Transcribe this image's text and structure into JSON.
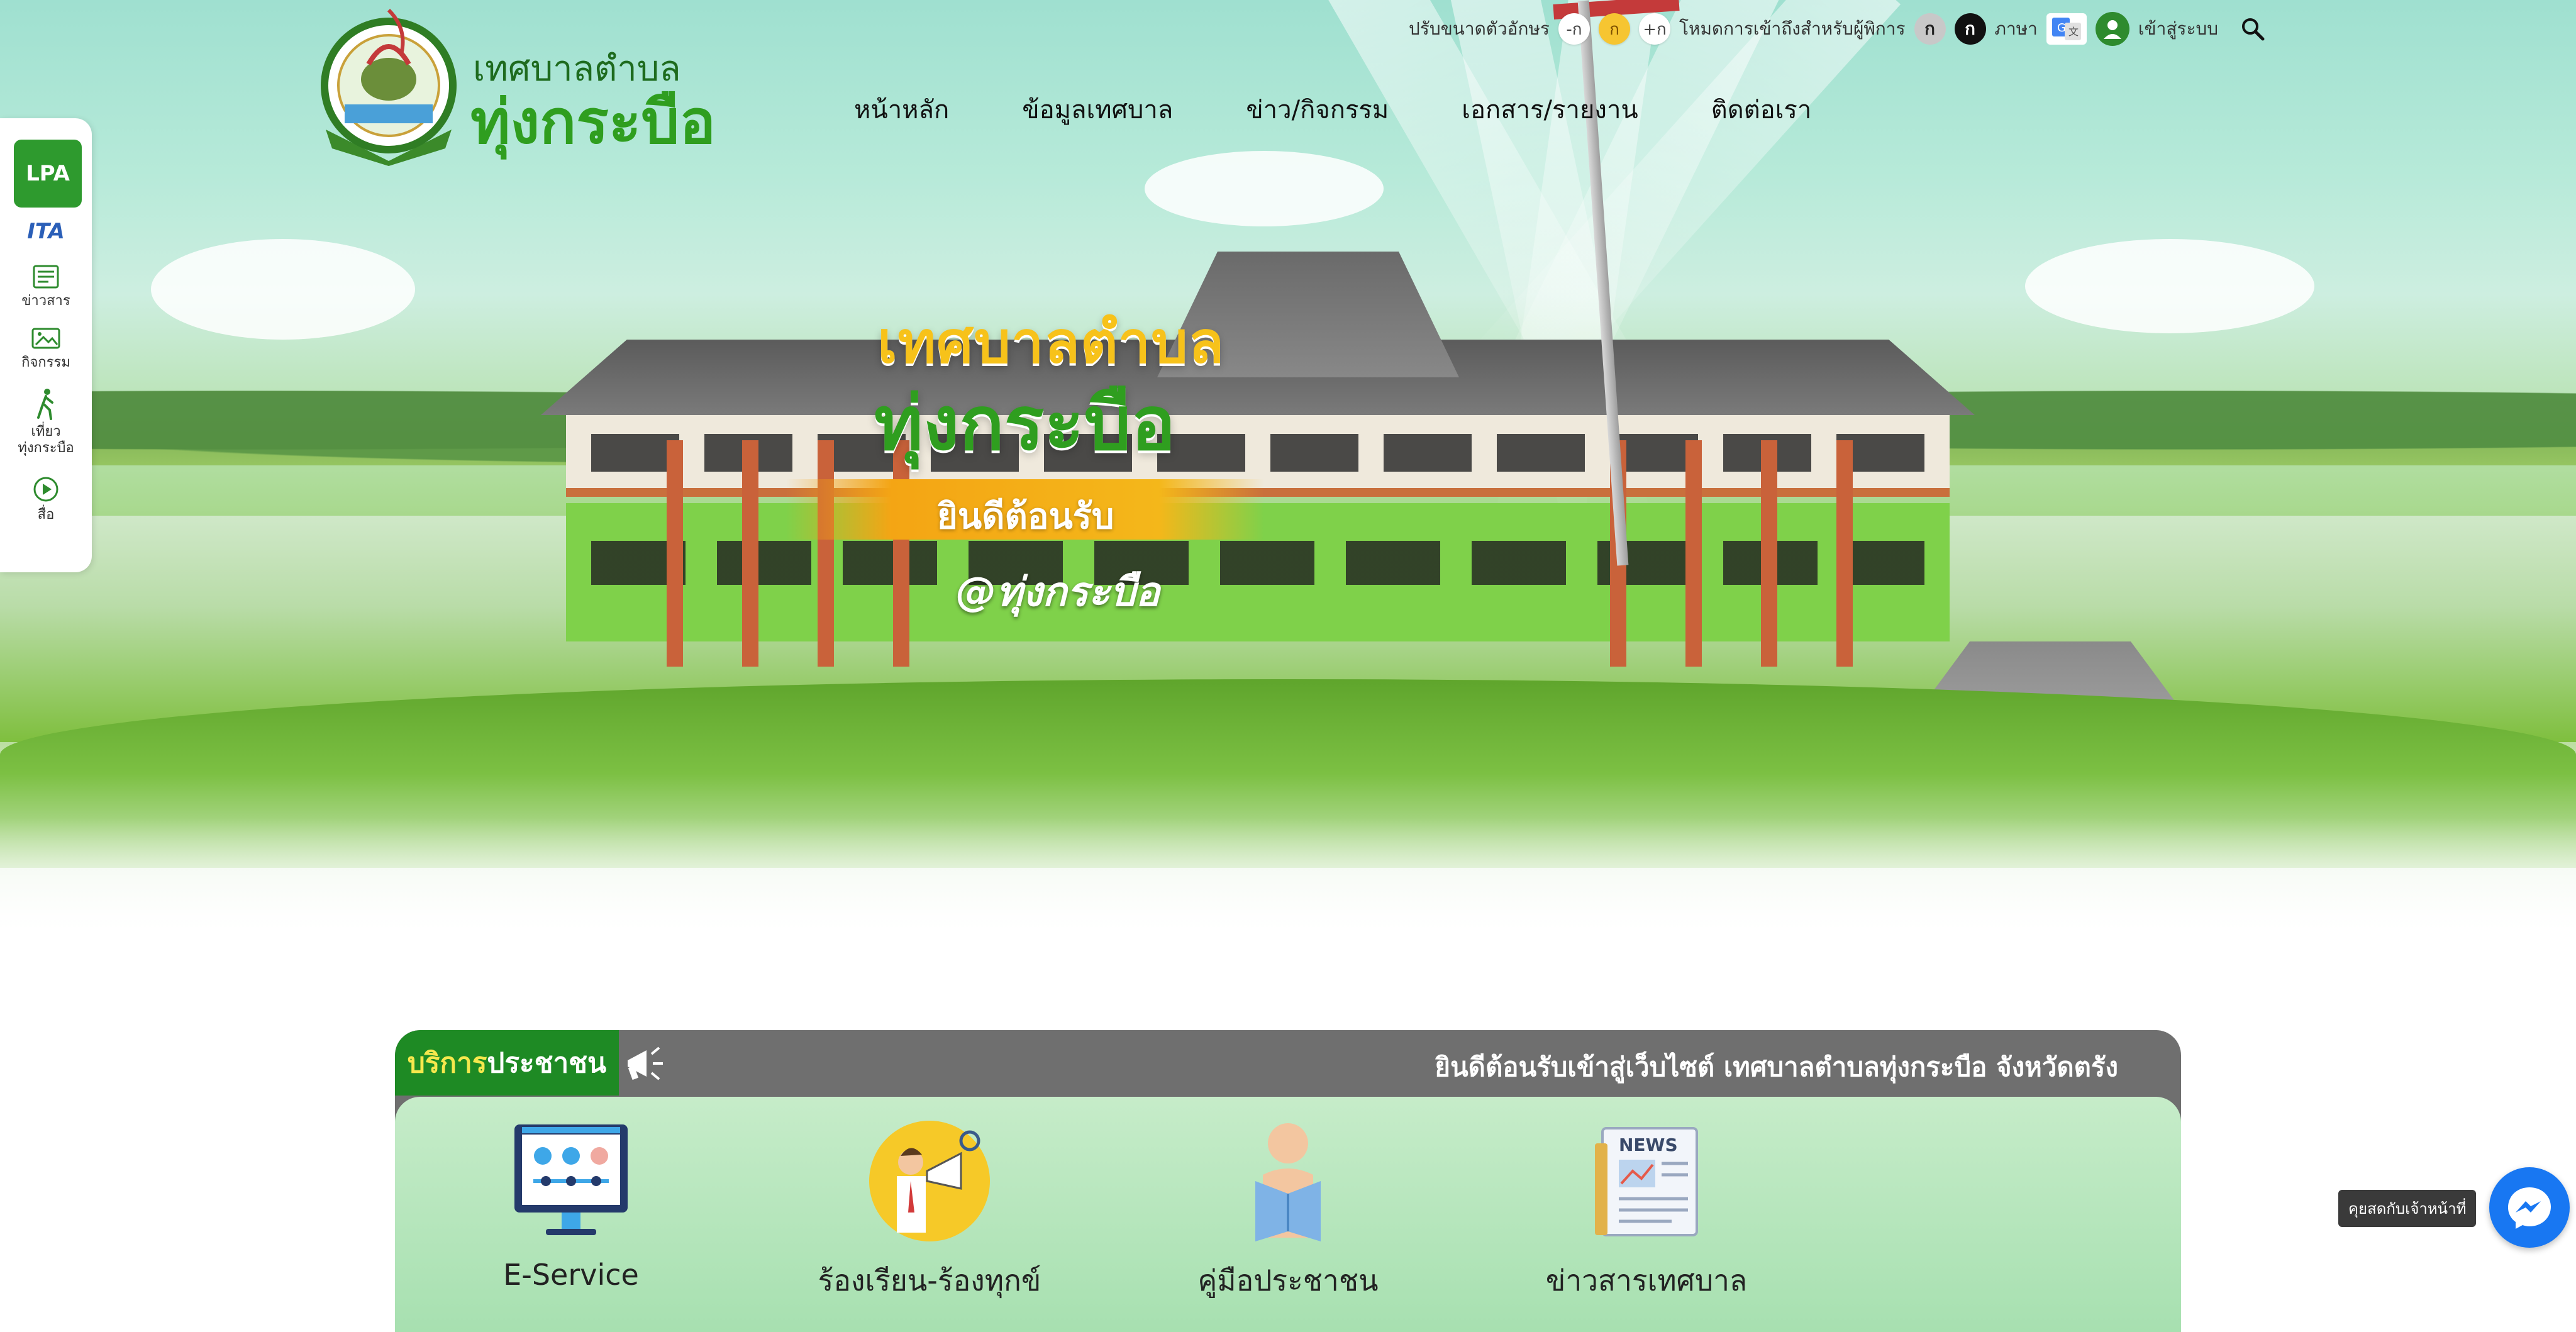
{
  "topbar": {
    "font_size_label": "ปรับขนาดตัวอักษร",
    "font_smaller": "-ก",
    "font_normal": "ก",
    "font_larger": "+ก",
    "accessibility_label": "โหมดการเข้าถึงสำหรับผู้พิการ",
    "mode_gray": "ก",
    "mode_dark": "ก",
    "language_label": "ภาษา",
    "login_label": "เข้าสู่ระบบ"
  },
  "logo": {
    "line1": "เทศบาลตำบล",
    "line2": "ทุ่งกระบือ"
  },
  "nav": {
    "items": [
      "หน้าหลัก",
      "ข้อมูลเทศบาล",
      "ข่าว/กิจกรรม",
      "เอกสาร/รายงาน",
      "ติดต่อเรา"
    ]
  },
  "hero": {
    "title_line1": "เทศบาลตำบล",
    "title_line2": "ทุ่งกระบือ",
    "welcome": "ยินดีต้อนรับ",
    "hashtag": "@ทุ่งกระบือ"
  },
  "sidebar": {
    "lpa": "LPA",
    "ita": "ITA",
    "items": [
      {
        "label": "ข่าวสาร"
      },
      {
        "label": "กิจกรรม"
      },
      {
        "label": "เที่ยว\nทุ่งกระบือ"
      },
      {
        "label": "สื่อ"
      }
    ]
  },
  "services": {
    "tab_highlight": "บริการ",
    "tab_rest": "ประชาชน",
    "marquee": "ยินดีต้อนรับเข้าสู่เว็บไซต์ เทศบาลตำบลทุ่งกระบือ จังหวัดตรัง",
    "items": [
      {
        "label": "E-Service"
      },
      {
        "label": "ร้องเรียน-ร้องทุกข์"
      },
      {
        "label": "คู่มือประชาชน"
      },
      {
        "label": "ข่าวสารเทศบาล"
      }
    ]
  },
  "chat": {
    "tooltip": "คุยสดกับเจ้าหน้าที่"
  },
  "colors": {
    "brand_green": "#2f9e1f",
    "accent_yellow": "#f7c21a",
    "panel_gray": "#6f6f6f",
    "messenger_blue": "#1877f2"
  }
}
